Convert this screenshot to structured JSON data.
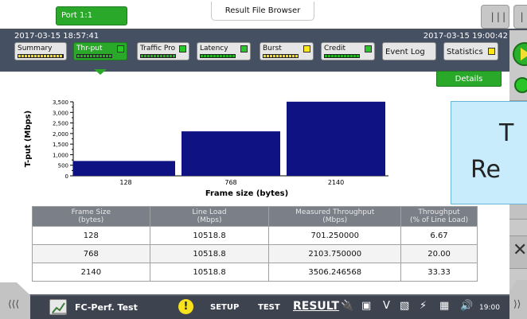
{
  "topbar": {
    "port_label": "Port 1:1",
    "browser_tab_label": "Result File Browser"
  },
  "header": {
    "start_time": "2017-03-15 18:57:41",
    "end_time": "2017-03-15 19:00:42"
  },
  "tabs": [
    {
      "label": "Summary",
      "status": "yellow"
    },
    {
      "label": "Thr-put",
      "status": "green",
      "active": true
    },
    {
      "label": "Traffic Pro",
      "status": "green"
    },
    {
      "label": "Latency",
      "status": "green"
    },
    {
      "label": "Burst",
      "status": "yellow"
    },
    {
      "label": "Credit",
      "status": "green"
    },
    {
      "label": "Event Log"
    },
    {
      "label": "Statistics",
      "status": "yellow"
    }
  ],
  "details_label": "Details",
  "chart_data": {
    "type": "bar",
    "categories": [
      "128",
      "768",
      "2140"
    ],
    "values": [
      701.25,
      2103.75,
      3506.246568
    ],
    "xlabel": "Frame size (bytes)",
    "ylabel": "T-put (Mbps)",
    "ylim": [
      0,
      3500
    ],
    "yticks": [
      "0",
      "500",
      "1,000",
      "1,500",
      "2,000",
      "2,500",
      "3,000",
      "3,500"
    ],
    "bar_color": "#0e1282",
    "grid": false
  },
  "table": {
    "headers": [
      [
        "Frame Size",
        "(bytes)"
      ],
      [
        "Line Load",
        "(Mbps)"
      ],
      [
        "Measured Throughput",
        "(Mbps)"
      ],
      [
        "Throughput",
        "(% of Line Load)"
      ]
    ],
    "rows": [
      [
        "128",
        "10518.8",
        "701.250000",
        "6.67"
      ],
      [
        "768",
        "10518.8",
        "2103.750000",
        "20.00"
      ],
      [
        "2140",
        "10518.8",
        "3506.246568",
        "33.33"
      ]
    ]
  },
  "overlay": {
    "line1": "T",
    "line2": "Re"
  },
  "bottombar": {
    "app_name": "FC-Perf. Test",
    "setup_label": "SETUP",
    "test_label": "TEST",
    "result_label": "RESULT",
    "clock": "19:00"
  },
  "colors": {
    "active_green": "#2aa82a",
    "header_bg": "#465063",
    "bar": "#0e1282",
    "status_yellow": "#ffe61a"
  }
}
